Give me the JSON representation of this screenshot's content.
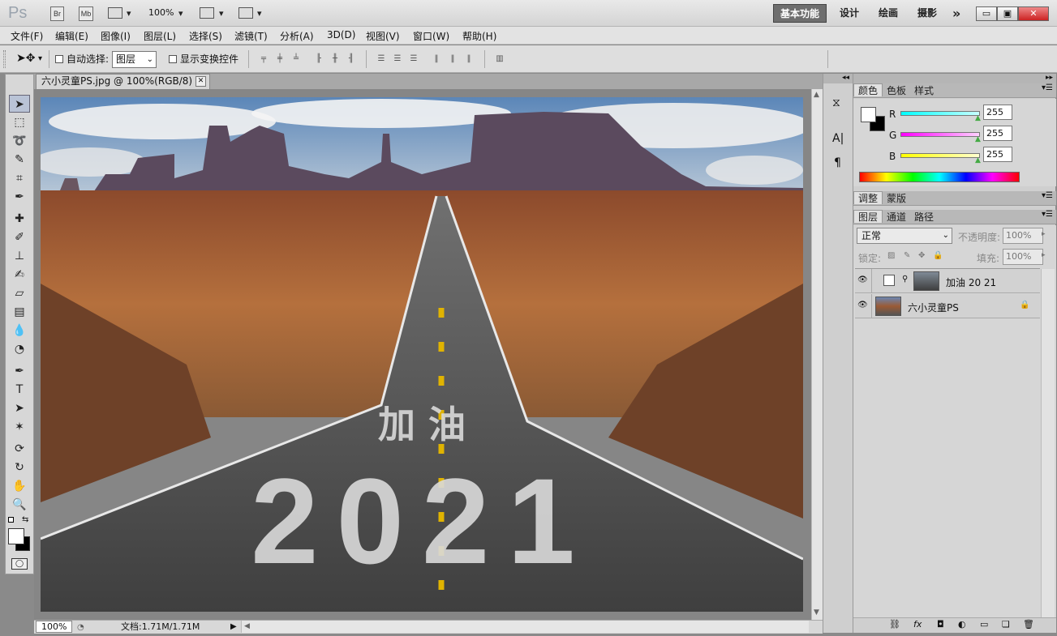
{
  "app": {
    "logo": "Ps"
  },
  "titlebar": {
    "launch_icons": [
      "Br",
      "Mb"
    ],
    "zoom_value": "100%",
    "workspaces": [
      "基本功能",
      "设计",
      "绘画",
      "摄影"
    ],
    "more_label": "»",
    "window_buttons": {
      "minimize": "▭",
      "maximize": "▣",
      "close": "✕"
    }
  },
  "menubar": {
    "items": [
      "文件(F)",
      "编辑(E)",
      "图像(I)",
      "图层(L)",
      "选择(S)",
      "滤镜(T)",
      "分析(A)",
      "3D(D)",
      "视图(V)",
      "窗口(W)",
      "帮助(H)"
    ]
  },
  "options": {
    "auto_select_label": "自动选择:",
    "auto_select_value": "图层",
    "show_transform_label": "显示变换控件"
  },
  "document": {
    "tab_title": "六小灵童PS.jpg @ 100%(RGB/8) *",
    "canvas_text_top": "加 油",
    "canvas_text_bottom": "2021"
  },
  "status": {
    "zoom": "100%",
    "doc_label": "文档:1.71M/1.71M"
  },
  "color_panel": {
    "tabs": [
      "颜色",
      "色板",
      "样式"
    ],
    "channels": [
      {
        "name": "R",
        "value": "255",
        "color": "#00e5ef"
      },
      {
        "name": "G",
        "value": "255",
        "color": "#ef00ef"
      },
      {
        "name": "B",
        "value": "255",
        "color": "#efef00"
      }
    ]
  },
  "adjust_panel": {
    "tabs": [
      "调整",
      "蒙版"
    ]
  },
  "layers_panel": {
    "tabs": [
      "图层",
      "通道",
      "路径"
    ],
    "blend_mode": "正常",
    "opacity_label": "不透明度:",
    "opacity_value": "100%",
    "lock_label": "锁定:",
    "fill_label": "填充:",
    "fill_value": "100%",
    "layers": [
      {
        "name": "加油 20 21"
      },
      {
        "name": "六小灵童PS"
      }
    ],
    "footer_icons": [
      "link-icon",
      "fx-icon",
      "mask-icon",
      "adjustment-icon",
      "group-icon",
      "new-layer-icon",
      "trash-icon"
    ],
    "footer_labels": [
      "⛓",
      "fx",
      "◘",
      "◐",
      "▭",
      "❏",
      "🗑"
    ]
  }
}
